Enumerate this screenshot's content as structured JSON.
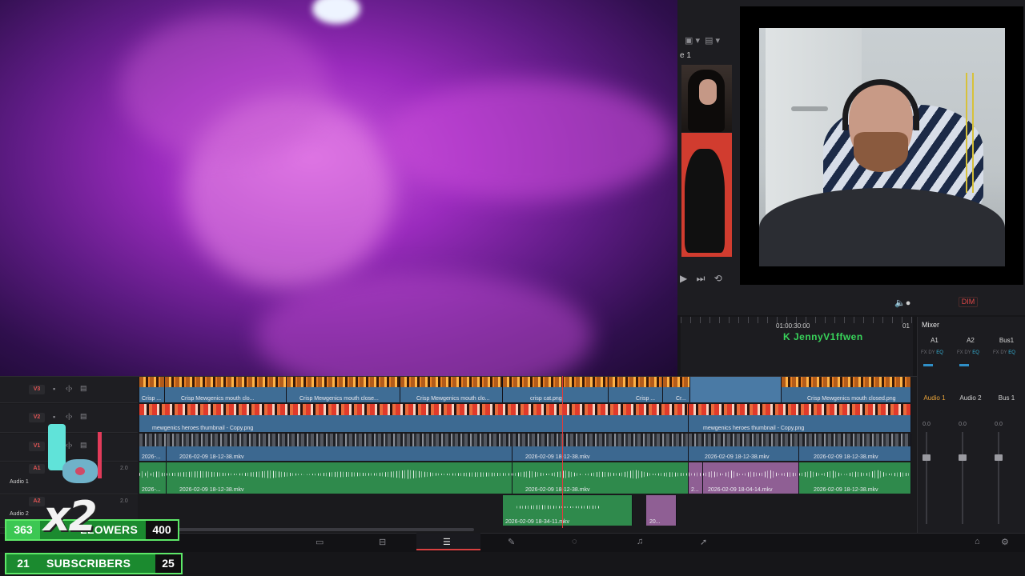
{
  "timeline_name": "e 1",
  "timecode": "01:00:30:00",
  "timecode2": "01",
  "dim_label": "DIM",
  "username": "JennyV1ffwen",
  "mixer": {
    "title": "Mixer",
    "columns": [
      "A1",
      "A2",
      "Bus1"
    ],
    "strips": [
      "Audio 1",
      "Audio 2",
      "Bus 1"
    ],
    "fx_labels": [
      "FX",
      "DY",
      "EQ"
    ],
    "level": "0.0"
  },
  "tracks": {
    "v3": {
      "badge": "V3"
    },
    "v2": {
      "badge": "V2"
    },
    "v1": {
      "badge": "V1"
    },
    "a1": {
      "badge": "A1",
      "name": "Audio 1",
      "level": "2.0"
    },
    "a2": {
      "badge": "A2",
      "name": "Audio 2",
      "level": "2.0"
    }
  },
  "clips": {
    "v3": [
      {
        "label": "Crisp ..."
      },
      {
        "label": "Crisp Mewgenics mouth clo..."
      },
      {
        "label": "Crisp Mewgenics mouth close..."
      },
      {
        "label": "Crisp Mewgenics mouth clo..."
      },
      {
        "label": "crisp cat.png"
      },
      {
        "label": "Crisp ..."
      },
      {
        "label": "Cr..."
      },
      {
        "label": "Crisp Mewgenics mouth closed.png"
      }
    ],
    "v2": [
      {
        "label": "mewgenics heroes thumbnail - Copy.png"
      },
      {
        "label": "mewgenics heroes thumbnail - Copy.png"
      }
    ],
    "v1": [
      {
        "label": "2026-..."
      },
      {
        "label": "2026-02-09 18-12-38.mkv"
      },
      {
        "label": "2026-02-09 18-12-38.mkv"
      },
      {
        "label": "2026-02-09 18-12-38.mkv"
      },
      {
        "label": "2026-02-09 18-12-38.mkv"
      }
    ],
    "a1": [
      {
        "label": "2026-..."
      },
      {
        "label": "2026-02-09 18-12-38.mkv"
      },
      {
        "label": "2026-02-09 18-12-38.mkv"
      },
      {
        "label": "2..."
      },
      {
        "label": "2026-02-09 18-04-14.mkv"
      },
      {
        "label": "2026-02-09 18-12-38.mkv"
      }
    ],
    "a2": [
      {
        "label": "2026-02-09 18-34-11.mkv"
      },
      {
        "label": "20..."
      }
    ]
  },
  "overlay": {
    "multiplier": "x2",
    "followers": {
      "current": "363",
      "label": "LLOWERS",
      "goal": "400"
    },
    "subscribers": {
      "current": "21",
      "label": "SUBSCRIBERS",
      "goal": "25"
    }
  },
  "icons": [
    "speaker-icon",
    "play-icon",
    "fast-forward-icon",
    "loop-icon",
    "home-icon",
    "gear-icon",
    "media-page-icon",
    "cut-page-icon",
    "edit-page-icon",
    "fusion-page-icon",
    "color-page-icon",
    "fairlight-page-icon",
    "deliver-page-icon"
  ]
}
